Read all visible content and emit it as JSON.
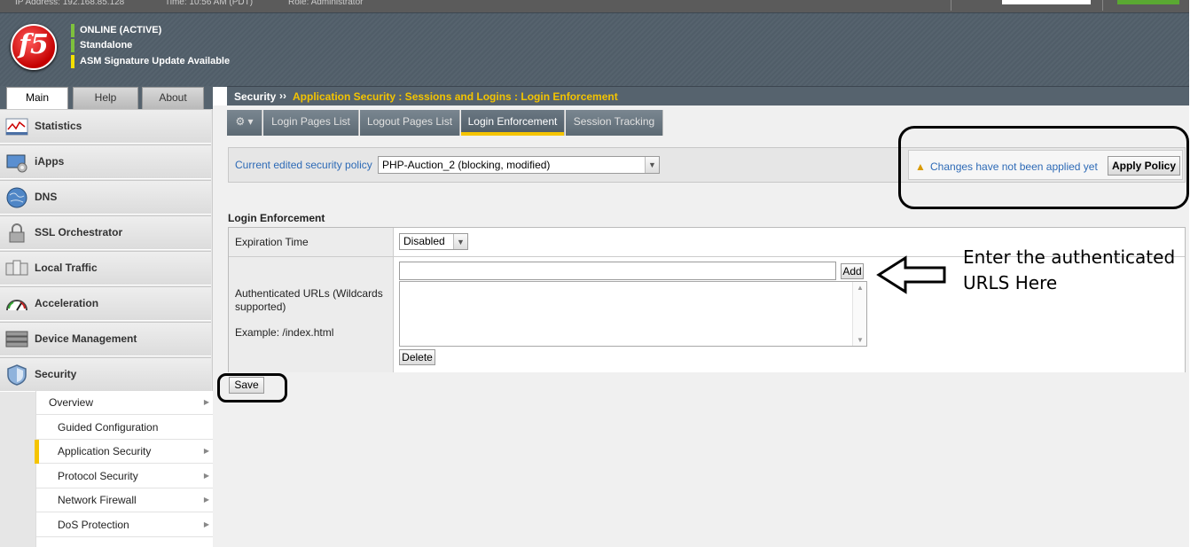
{
  "topbar": {
    "ip": "IP Address:  192.168.85.128",
    "time": "Time:  10:56 AM (PDT)",
    "role": "Role:  Administrator"
  },
  "logo": {
    "text": "f5"
  },
  "header": {
    "statuses": [
      {
        "text": "ONLINE (ACTIVE)",
        "color": "#7ec13d"
      },
      {
        "text": "Standalone",
        "color": "#7ec13d"
      },
      {
        "text": "ASM Signature Update Available",
        "color": "#f4e000"
      }
    ]
  },
  "tabs": {
    "main": "Main",
    "help": "Help",
    "about": "About"
  },
  "sidebar": {
    "items": [
      {
        "label": "Statistics",
        "icon": "statistics-icon"
      },
      {
        "label": "iApps",
        "icon": "iapps-icon"
      },
      {
        "label": "DNS",
        "icon": "dns-globe-icon"
      },
      {
        "label": "SSL Orchestrator",
        "icon": "lock-icon"
      },
      {
        "label": "Local Traffic",
        "icon": "local-traffic-icon"
      },
      {
        "label": "Acceleration",
        "icon": "speedometer-icon"
      },
      {
        "label": "Device Management",
        "icon": "server-icon"
      },
      {
        "label": "Security",
        "icon": "shield-icon"
      }
    ],
    "security_sub": [
      {
        "label": "Overview",
        "arrow": true
      },
      {
        "label": "Guided Configuration",
        "arrow": false
      },
      {
        "label": "Application Security",
        "arrow": true,
        "selected": true
      },
      {
        "label": "Protocol Security",
        "arrow": true
      },
      {
        "label": "Network Firewall",
        "arrow": true
      },
      {
        "label": "DoS Protection",
        "arrow": true
      }
    ]
  },
  "breadcrumb": {
    "root": "Security",
    "separator": "››",
    "path": "Application Security : Sessions and Logins : Login Enforcement"
  },
  "subtabs": {
    "gear": "gear-dropdown-icon",
    "items": [
      "Login Pages List",
      "Logout Pages List",
      "Login Enforcement",
      "Session Tracking"
    ],
    "active": "Login Enforcement"
  },
  "policy": {
    "label": "Current edited security policy",
    "selected": "PHP-Auction_2 (blocking, modified)",
    "warning": "Changes have not been applied yet",
    "apply_label": "Apply Policy"
  },
  "login_enforcement": {
    "title": "Login Enforcement",
    "expiration_label": "Expiration Time",
    "expiration_value": "Disabled",
    "urls_label": "Authenticated URLs (Wildcards supported)",
    "example": "Example: /index.html",
    "url_input_value": "",
    "add_label": "Add",
    "delete_label": "Delete",
    "save_label": "Save"
  },
  "annotation": {
    "note_line1": "Enter the authenticated",
    "note_line2": "URLS Here"
  },
  "colors": {
    "header_bg": "#56636e",
    "accent_yellow": "#f5c400",
    "link_blue": "#2d6ab6",
    "online_green": "#7ec13d"
  }
}
